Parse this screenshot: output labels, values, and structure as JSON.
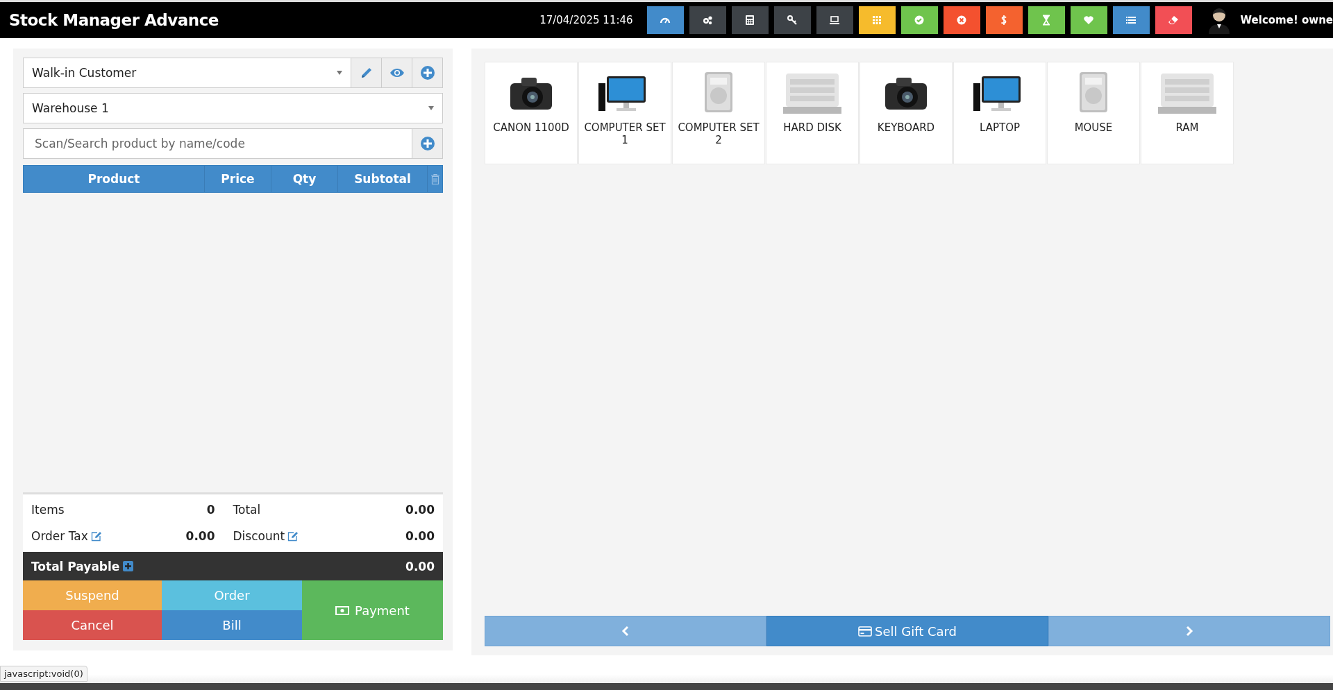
{
  "app": {
    "title": "Stock Manager Advance",
    "datetime": "17/04/2025 11:46",
    "welcome": "Welcome! owne"
  },
  "toolbar": [
    {
      "color": "#428bca"
    },
    {
      "color": "#3d4247"
    },
    {
      "color": "#3d4247"
    },
    {
      "color": "#3d4247"
    },
    {
      "color": "#3d4247"
    },
    {
      "color": "#f6bb2c"
    },
    {
      "color": "#6fc44d"
    },
    {
      "color": "#f4512f"
    },
    {
      "color": "#f4622f"
    },
    {
      "color": "#6fc44d"
    },
    {
      "color": "#6fc44d"
    },
    {
      "color": "#428bca"
    },
    {
      "color": "#f24f55"
    }
  ],
  "customer": {
    "value": "Walk-in Customer"
  },
  "warehouse": {
    "value": "Warehouse 1"
  },
  "search": {
    "placeholder": "Scan/Search product by name/code"
  },
  "cart": {
    "columns": [
      "Product",
      "Price",
      "Qty",
      "Subtotal"
    ]
  },
  "totals": [
    {
      "label": "Items",
      "value": "0",
      "editable": false
    },
    {
      "label": "Total",
      "value": "0.00",
      "editable": false
    },
    {
      "label": "Order Tax",
      "value": "0.00",
      "editable": true
    },
    {
      "label": "Discount",
      "value": "0.00",
      "editable": true
    }
  ],
  "total_payable": {
    "label": "Total Payable",
    "value": "0.00"
  },
  "actions": [
    {
      "label": "Suspend",
      "kind": "suspend"
    },
    {
      "label": "Order",
      "kind": "order"
    },
    {
      "label": "Payment",
      "kind": "payment"
    },
    {
      "label": "Cancel",
      "kind": "cancel"
    },
    {
      "label": "Bill",
      "kind": "bill"
    }
  ],
  "products": [
    {
      "name": "CANON 1100D",
      "kind": "picture"
    },
    {
      "name": "COMPUTER SET 1",
      "kind": "picture"
    },
    {
      "name": "COMPUTER SET 2",
      "kind": "picture"
    },
    {
      "name": "HARD DISK",
      "kind": "picture"
    },
    {
      "name": "KEYBOARD",
      "kind": "picture"
    },
    {
      "name": "LAPTOP",
      "kind": "picture"
    },
    {
      "name": "MOUSE",
      "kind": "picture"
    },
    {
      "name": "RAM",
      "kind": "picture"
    }
  ],
  "pager": {
    "label": "Sell Gift Card"
  },
  "status_url": "javascript:void(0)"
}
